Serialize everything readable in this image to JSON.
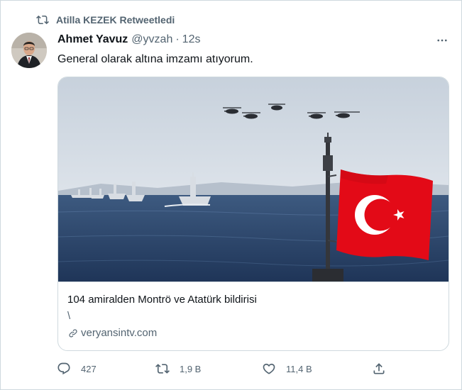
{
  "retweet": {
    "label": "Atilla KEZEK Retweetledi",
    "icon": "retweet-icon"
  },
  "tweet": {
    "author_name": "Ahmet Yavuz",
    "author_handle": "@yvzah",
    "separator": "·",
    "time": "12s",
    "text": "General olarak altına imzamı atıyorum.",
    "more_icon": "more-horizontal-icon"
  },
  "card": {
    "title": "104 amiralden Montrö ve Atatürk bildirisi",
    "description": "\\",
    "domain": "veryansintv.com",
    "domain_icon": "link-icon",
    "image_subject": "naval ships and helicopters with Turkish flag"
  },
  "actions": {
    "reply_count": "427",
    "retweet_count": "1,9 B",
    "like_count": "11,4 B",
    "reply_icon": "reply-icon",
    "retweet_icon": "retweet-icon",
    "like_icon": "heart-icon",
    "share_icon": "share-icon"
  },
  "colors": {
    "text_primary": "#0f1419",
    "text_secondary": "#536471",
    "border": "#cfd9de",
    "flag_red": "#e30a17"
  }
}
